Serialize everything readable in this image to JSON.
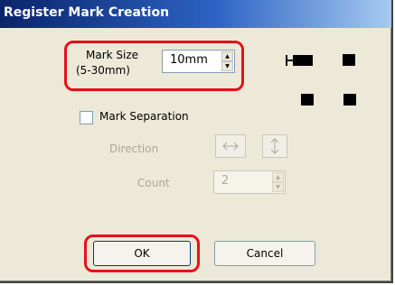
{
  "dialog": {
    "title": "Register Mark Creation",
    "mark_size_label_1": "Mark Size",
    "mark_size_label_2": "(5-30mm)",
    "mark_size_value": "10mm",
    "mark_separation_label": "Mark Separation",
    "mark_separation_checked": false,
    "direction_label": "Direction",
    "count_label": "Count",
    "count_value": "2",
    "ok_label": "OK",
    "cancel_label": "Cancel"
  },
  "icons": {
    "spin_up": "spin-up-icon",
    "spin_down": "spin-down-icon",
    "direction_horizontal": "horizontal-arrows-icon",
    "direction_vertical": "vertical-arrows-icon"
  },
  "colors": {
    "title_bar_start": "#0a246a",
    "title_bar_end": "#a6caf0",
    "dialog_background": "#ece9d8",
    "highlight": "#e8101a",
    "disabled_text": "#aca899"
  }
}
